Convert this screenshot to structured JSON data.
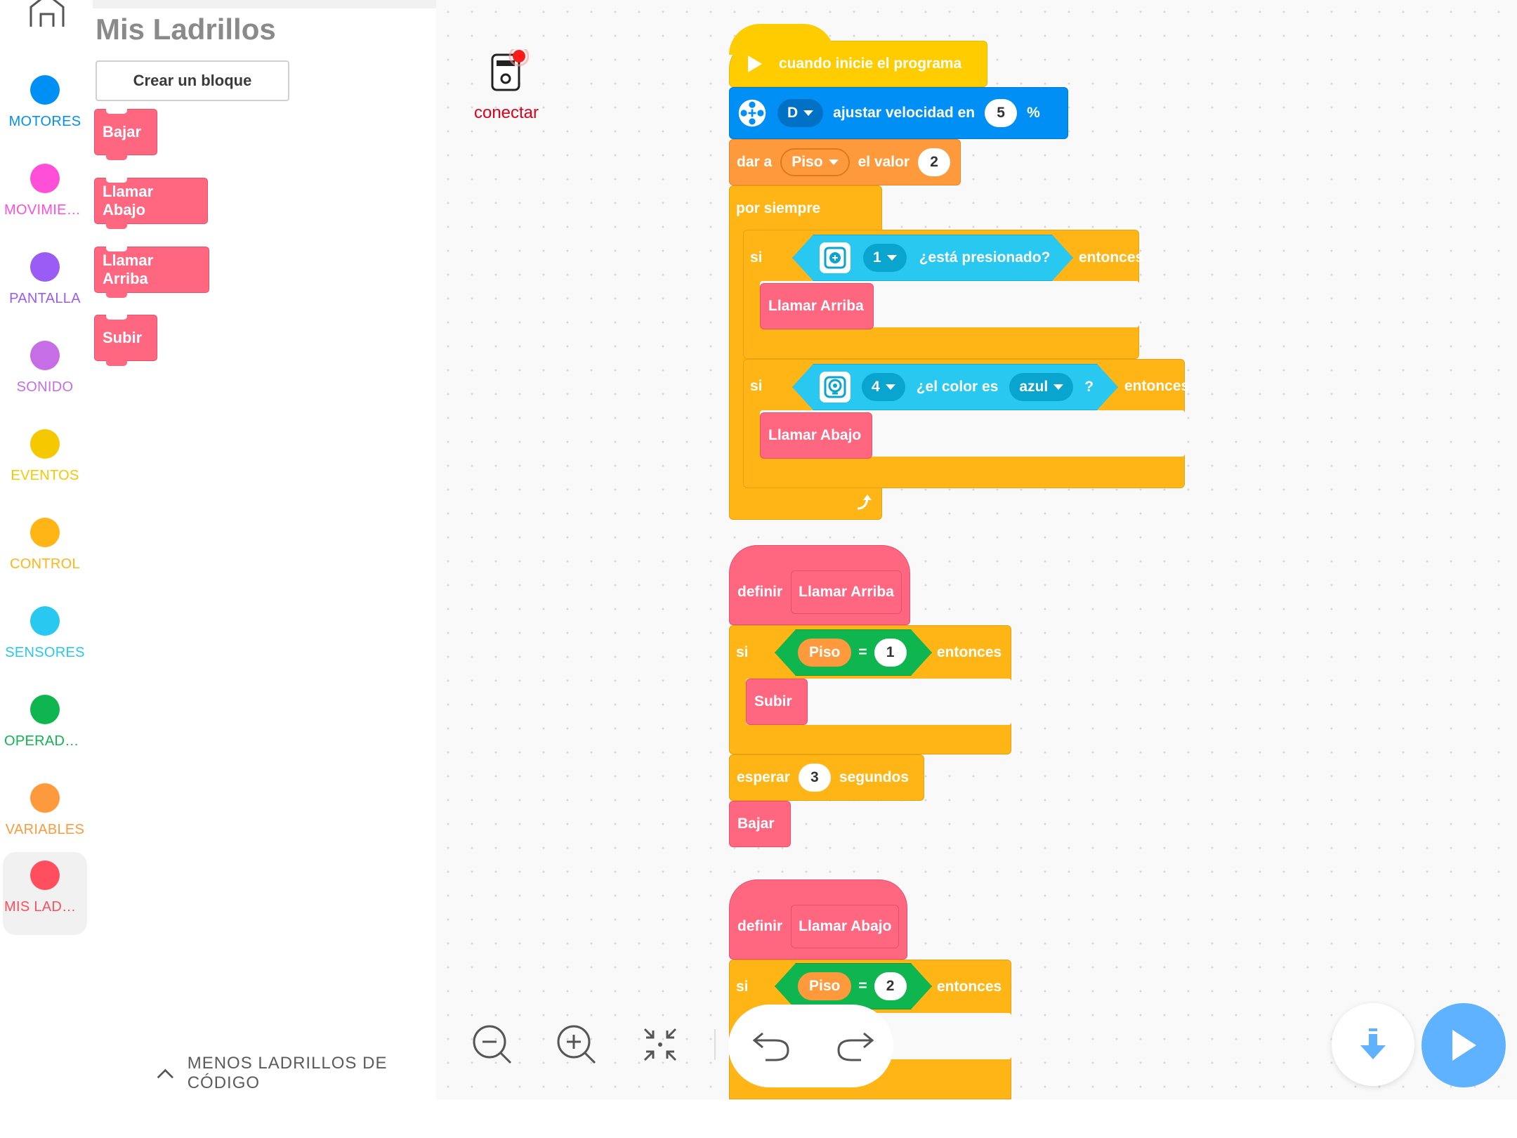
{
  "categories": [
    {
      "label": "MOTORES",
      "color": "#0090f5"
    },
    {
      "label": "MOVIMIENTO",
      "color": "#ff4fd8"
    },
    {
      "label": "PANTALLA",
      "color": "#9a5cf5"
    },
    {
      "label": "SONIDO",
      "color": "#c56ee6"
    },
    {
      "label": "EVENTOS",
      "color": "#f5c800"
    },
    {
      "label": "CONTROL",
      "color": "#ffb515"
    },
    {
      "label": "SENSORES",
      "color": "#28c8f0"
    },
    {
      "label": "OPERADORES",
      "color": "#0fb64f"
    },
    {
      "label": "VARIABLES",
      "color": "#ff9a3c"
    },
    {
      "label": "MIS LADRILLOS",
      "color": "#ff4f5e"
    }
  ],
  "palette": {
    "title": "Mis Ladrillos",
    "make_block": "Crear un bloque",
    "blocks": [
      "Bajar",
      "Llamar Abajo",
      "Llamar Arriba",
      "Subir"
    ],
    "less_bricks": "MENOS LADRILLOS DE CÓDIGO"
  },
  "connect": {
    "label": "conectar"
  },
  "script": {
    "hat": "cuando inicie el programa",
    "motor_port": "D",
    "motor_set_speed": "ajustar velocidad en",
    "motor_speed": "5",
    "percent": "%",
    "set_var": "dar a",
    "var_name": "Piso",
    "set_value_label": "el valor",
    "set_value": "2",
    "forever": "por siempre",
    "if": "si",
    "then": "entonces",
    "button_port": "1",
    "is_pressed": "¿está presionado?",
    "call_up": "Llamar Arriba",
    "color_port": "4",
    "color_is": "¿el color es",
    "color_value": "azul",
    "question": "?",
    "call_down": "Llamar Abajo"
  },
  "def1": {
    "define": "definir",
    "name": "Llamar Arriba",
    "if": "si",
    "var": "Piso",
    "eq": "=",
    "value": "1",
    "then": "entonces",
    "call": "Subir",
    "wait": "esperar",
    "wait_value": "3",
    "seconds": "segundos",
    "after": "Bajar"
  },
  "def2": {
    "define": "definir",
    "name": "Llamar Abajo",
    "if": "si",
    "var": "Piso",
    "eq": "=",
    "value": "2",
    "then": "entonces"
  }
}
